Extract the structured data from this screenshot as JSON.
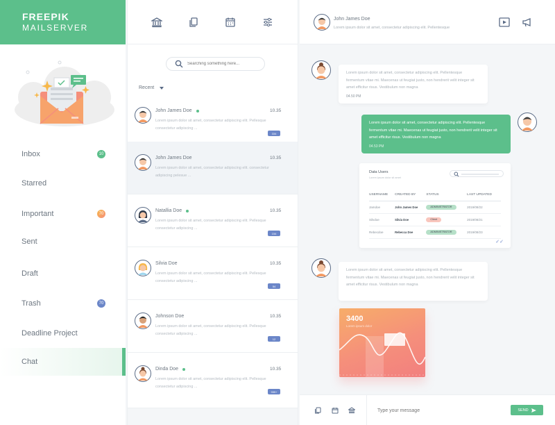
{
  "brand": {
    "line1": "FREEPIK",
    "line2": "MAILSERVER"
  },
  "colors": {
    "accent": "#5cbf8b",
    "badge_green": "#5cbf8b",
    "badge_orange": "#f39a63",
    "badge_blue": "#6b86c8"
  },
  "sidebar": {
    "items": [
      {
        "label": "Inbox",
        "badge": "10",
        "badge_color": "green",
        "active": false
      },
      {
        "label": "Starred",
        "badge": null,
        "active": false
      },
      {
        "label": "Important",
        "badge": "70",
        "badge_color": "orange",
        "active": false
      },
      {
        "label": "Sent",
        "badge": null,
        "active": false
      },
      {
        "label": "Draft",
        "badge": null,
        "active": false
      },
      {
        "label": "Trash",
        "badge": "70",
        "badge_color": "blue",
        "active": false
      },
      {
        "label": "Deadline Project",
        "badge": null,
        "active": false
      },
      {
        "label": "Chat",
        "badge": null,
        "active": true
      }
    ]
  },
  "toolbar": {
    "icons": [
      "bank-icon",
      "copy-icon",
      "calendar-icon",
      "sliders-icon"
    ]
  },
  "search": {
    "placeholder": "Searching something here..."
  },
  "filter": {
    "label": "Recent"
  },
  "messages": [
    {
      "name": "John James Doe",
      "online": true,
      "time": "10.35",
      "snippet": "Lorem ipsum dolor sit amet, consectetur adipiscing elit. Pellesque consectetur adipiscing ...",
      "count": "334",
      "selected": false
    },
    {
      "name": "John James Doe",
      "online": false,
      "time": "10.35",
      "snippet": "Lorem ipsum dolor sit amet, consectetur adipiscing elit. consectetur adipiscing pelesue ...",
      "count": "",
      "selected": true
    },
    {
      "name": "Natallia Doe",
      "online": true,
      "time": "10.35",
      "snippet": "Lorem ipsum dolor sit amet, consectetur adipiscing elit. Pellesque consectetur adipiscing ...",
      "count": "154",
      "selected": false
    },
    {
      "name": "Silvia Doe",
      "online": false,
      "time": "10.35",
      "snippet": "Lorem ipsum dolor sit amet, consectetur adipiscing elit. Pellesque consectetur adipiscing ...",
      "count": "54",
      "selected": false
    },
    {
      "name": "Johnson Doe",
      "online": false,
      "time": "10.35",
      "snippet": "Lorem ipsum dolor sit amet, consectetur adipiscing elit. Pellesque consectetur adipiscing ...",
      "count": "12",
      "selected": false
    },
    {
      "name": "Dinda Doe",
      "online": true,
      "time": "10.35",
      "snippet": "Lorem ipsum dolor sit amet, consectetur adipiscing elit. Pellesque consectetur adipiscing ...",
      "count": "999+",
      "selected": false
    }
  ],
  "chat": {
    "contact_name": "John James Doe",
    "contact_status": "Lorem ipsum dolor sit amet, consectetur adipiscing elit. Pellentesque",
    "bubble1": {
      "text": "Lorem ipsum dolor sit amet, consectetur adipiscing elit. Pellentesque fermentum vitae mi. Maecenas ut feugiat justo, non hendrerit velit integer sit amet efficitur risus. Vestibulum non magna",
      "time": "04.50 PM"
    },
    "bubble2": {
      "text": "Lorem ipsum dolor sit amet, consectetur adipiscing elit. Pellentesque fermentum vitae mi. Maecenas ut feugiat justo, non hendrerit velit integer sit amet efficitur risus. Vestibulum non magna",
      "time": "04.53 PM"
    },
    "bubble3": {
      "text": "Lorem ipsum dolor sit amet, consectetur adipiscing elit. Pellentesque fermentum vitae mi. Maecenas ut feugiat justo, non hendrerit velit integer sit amet efficitur risus. Vestibulum non magna",
      "time": ""
    },
    "table_card": {
      "title": "Data Users",
      "subtitle": "Lorem ipsum dolor sit amet",
      "headers": [
        "USERNAME",
        "CREATED BY",
        "STATUS",
        "LAST UPDATED"
      ],
      "rows": [
        [
          "Jamdoe",
          "John James Doe",
          "ADMINISTRATOR",
          "2019/08/22"
        ],
        [
          "Silvdoe",
          "Silvia Doe",
          "Client",
          "2019/08/21"
        ],
        [
          "Rebecdoe",
          "Rebecca Doe",
          "ADMINISTRATOR",
          "2019/08/23"
        ]
      ]
    },
    "stat_card": {
      "value": "3400",
      "label": "Lorem ipsum dolor"
    },
    "composer": {
      "placeholder": "Type your message",
      "send_label": "SEND"
    }
  }
}
